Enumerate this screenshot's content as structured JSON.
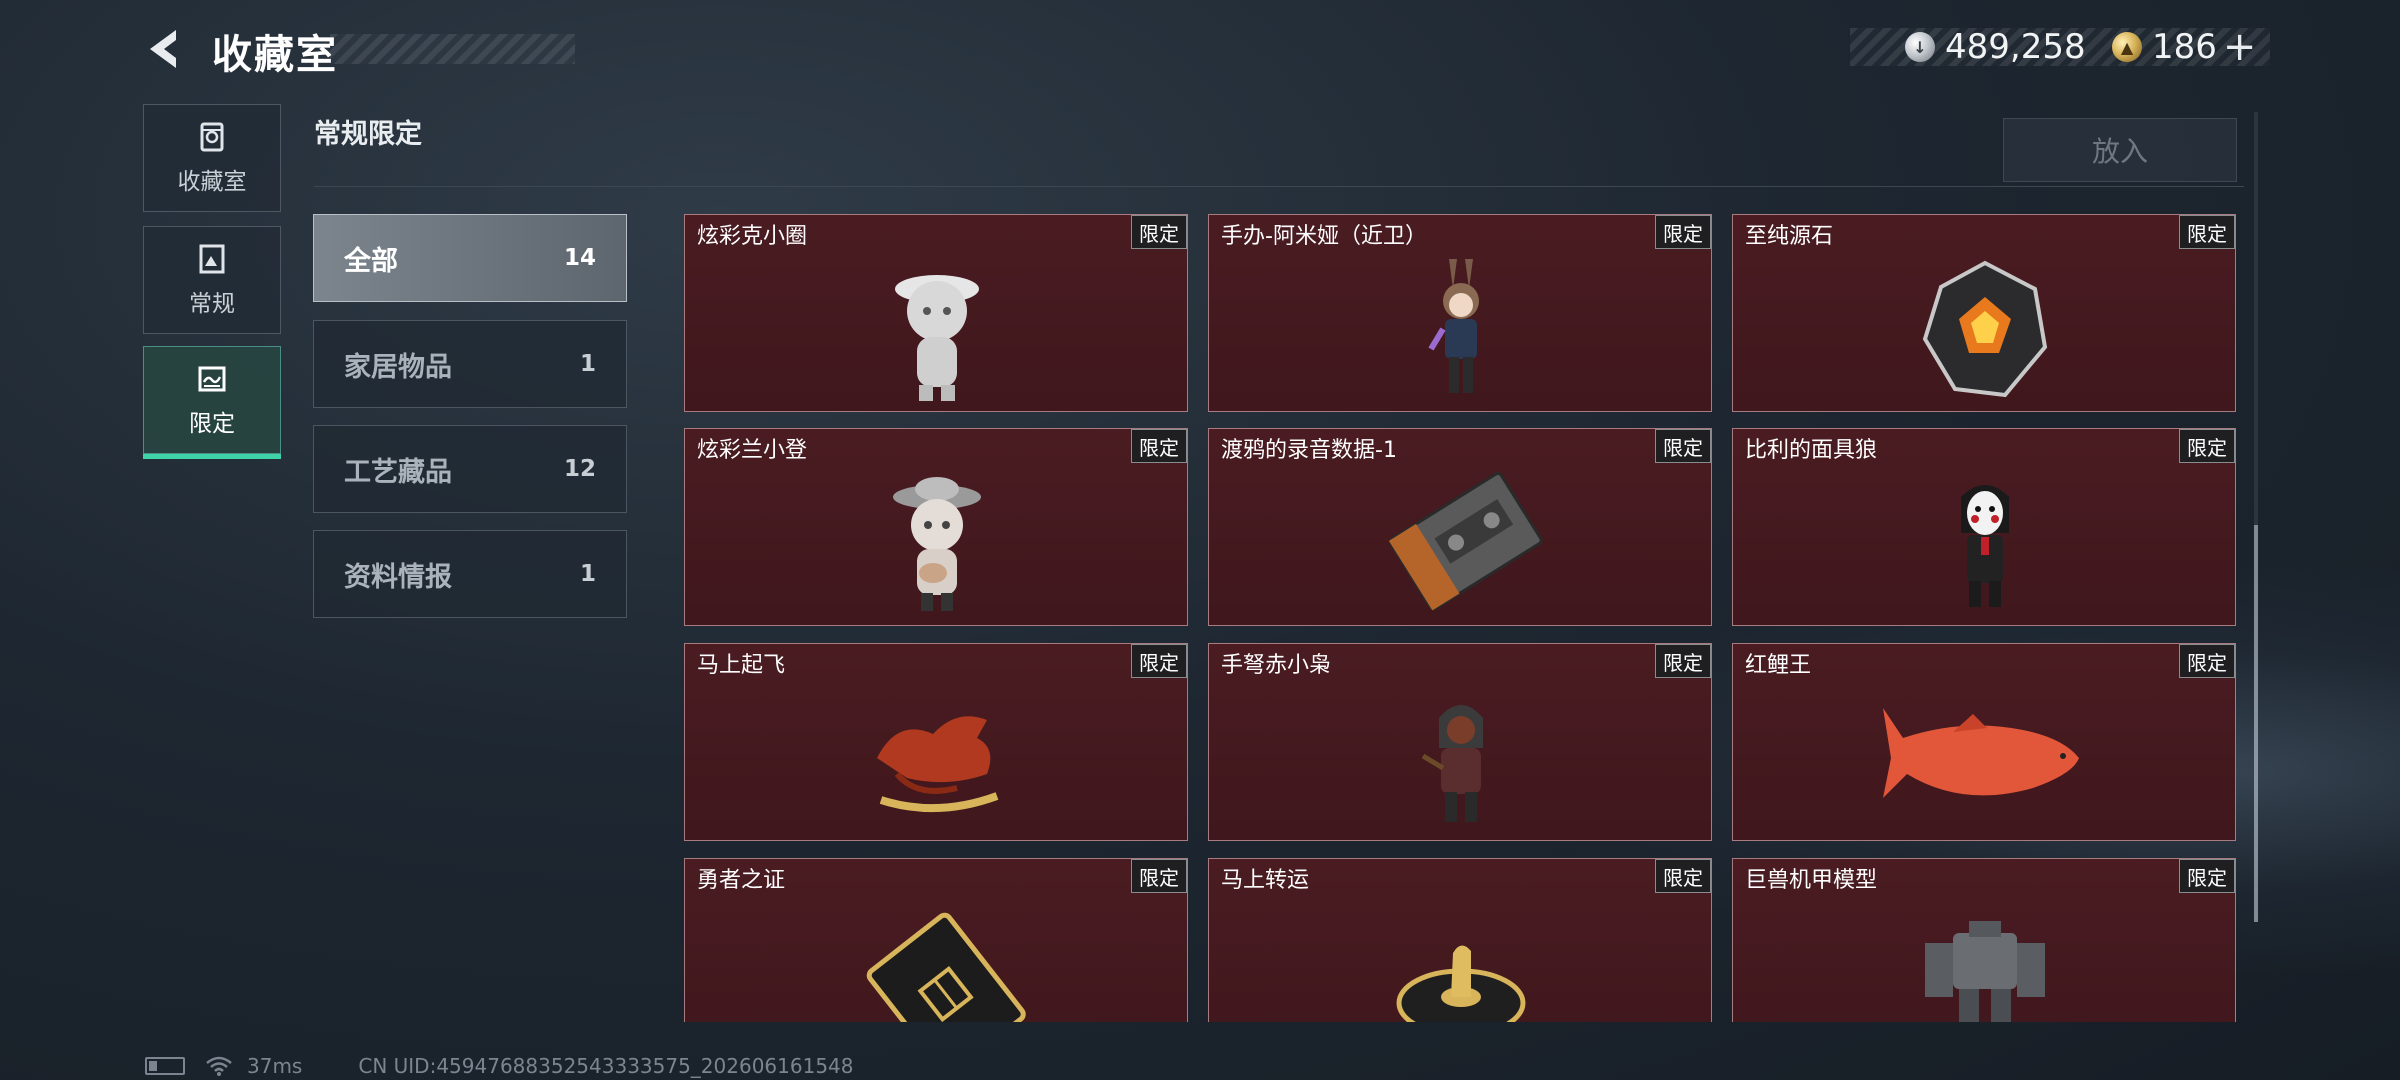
{
  "header": {
    "title": "收藏室",
    "currency_silver": "489,258",
    "currency_gold": "186",
    "plus_label": "+"
  },
  "nav": [
    {
      "label": "收藏室",
      "icon": "vault-icon"
    },
    {
      "label": "常规",
      "icon": "regular-icon"
    },
    {
      "label": "限定",
      "icon": "limited-icon",
      "active": true
    }
  ],
  "section": {
    "title": "常规限定",
    "put_in_label": "放入"
  },
  "categories": [
    {
      "label": "全部",
      "count": "14",
      "active": true
    },
    {
      "label": "家居物品",
      "count": "1"
    },
    {
      "label": "工艺藏品",
      "count": "12"
    },
    {
      "label": "资料情报",
      "count": "1"
    }
  ],
  "items": [
    {
      "name": "炫彩克小圈",
      "tag": "限定",
      "art": "figurine-white"
    },
    {
      "name": "手办-阿米娅（近卫）",
      "tag": "限定",
      "art": "figurine-amiya"
    },
    {
      "name": "至纯源石",
      "tag": "限定",
      "art": "crystal"
    },
    {
      "name": "炫彩兰小登",
      "tag": "限定",
      "art": "figurine-sombrero"
    },
    {
      "name": "渡鸦的录音数据-1",
      "tag": "限定",
      "art": "cassette"
    },
    {
      "name": "比利的面具狼",
      "tag": "限定",
      "art": "puppet"
    },
    {
      "name": "马上起飞",
      "tag": "限定",
      "art": "horse"
    },
    {
      "name": "手弩赤小枭",
      "tag": "限定",
      "art": "hooded-figure"
    },
    {
      "name": "红鲤王",
      "tag": "限定",
      "art": "koi-fish"
    },
    {
      "name": "勇者之证",
      "tag": "限定",
      "art": "card"
    },
    {
      "name": "马上转运",
      "tag": "限定",
      "art": "horse-wheel"
    },
    {
      "name": "巨兽机甲模型",
      "tag": "限定",
      "art": "mech"
    }
  ],
  "status": {
    "ping": "37ms",
    "uid": "CN UID:45947688352543333575_202606161548"
  },
  "colors": {
    "accent": "#3fd3a8",
    "card_bg": "#4a1c22",
    "card_border": "#a77b80"
  }
}
